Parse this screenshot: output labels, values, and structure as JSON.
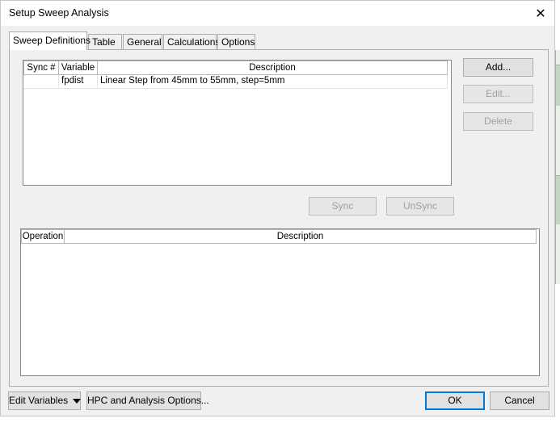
{
  "window": {
    "title": "Setup Sweep Analysis",
    "close_glyph": "✕"
  },
  "tabs": [
    {
      "label": "Sweep Definitions",
      "active": true
    },
    {
      "label": "Table",
      "active": false
    },
    {
      "label": "General",
      "active": false
    },
    {
      "label": "Calculations",
      "active": false
    },
    {
      "label": "Options",
      "active": false
    }
  ],
  "sweep_list": {
    "columns": [
      "Sync #",
      "Variable",
      "Description"
    ],
    "rows": [
      {
        "sync": "",
        "variable": "fpdist",
        "description": "Linear Step from 45mm to 55mm, step=5mm"
      }
    ]
  },
  "side_buttons": {
    "add": "Add...",
    "edit": "Edit...",
    "delete": "Delete"
  },
  "sync_buttons": {
    "sync": "Sync",
    "unsync": "UnSync"
  },
  "operation_list": {
    "columns": [
      "Operation",
      "Description"
    ],
    "rows": []
  },
  "footer": {
    "edit_variables": "Edit Variables",
    "hpc_options": "HPC and Analysis Options...",
    "ok": "OK",
    "cancel": "Cancel"
  },
  "icons": {
    "close": "close-icon",
    "dropdown": "dropdown-arrow-icon"
  },
  "colors": {
    "accent": "#0078d7",
    "dialog_bg": "#f0f0f0",
    "disabled_text": "#a0a0a0"
  }
}
